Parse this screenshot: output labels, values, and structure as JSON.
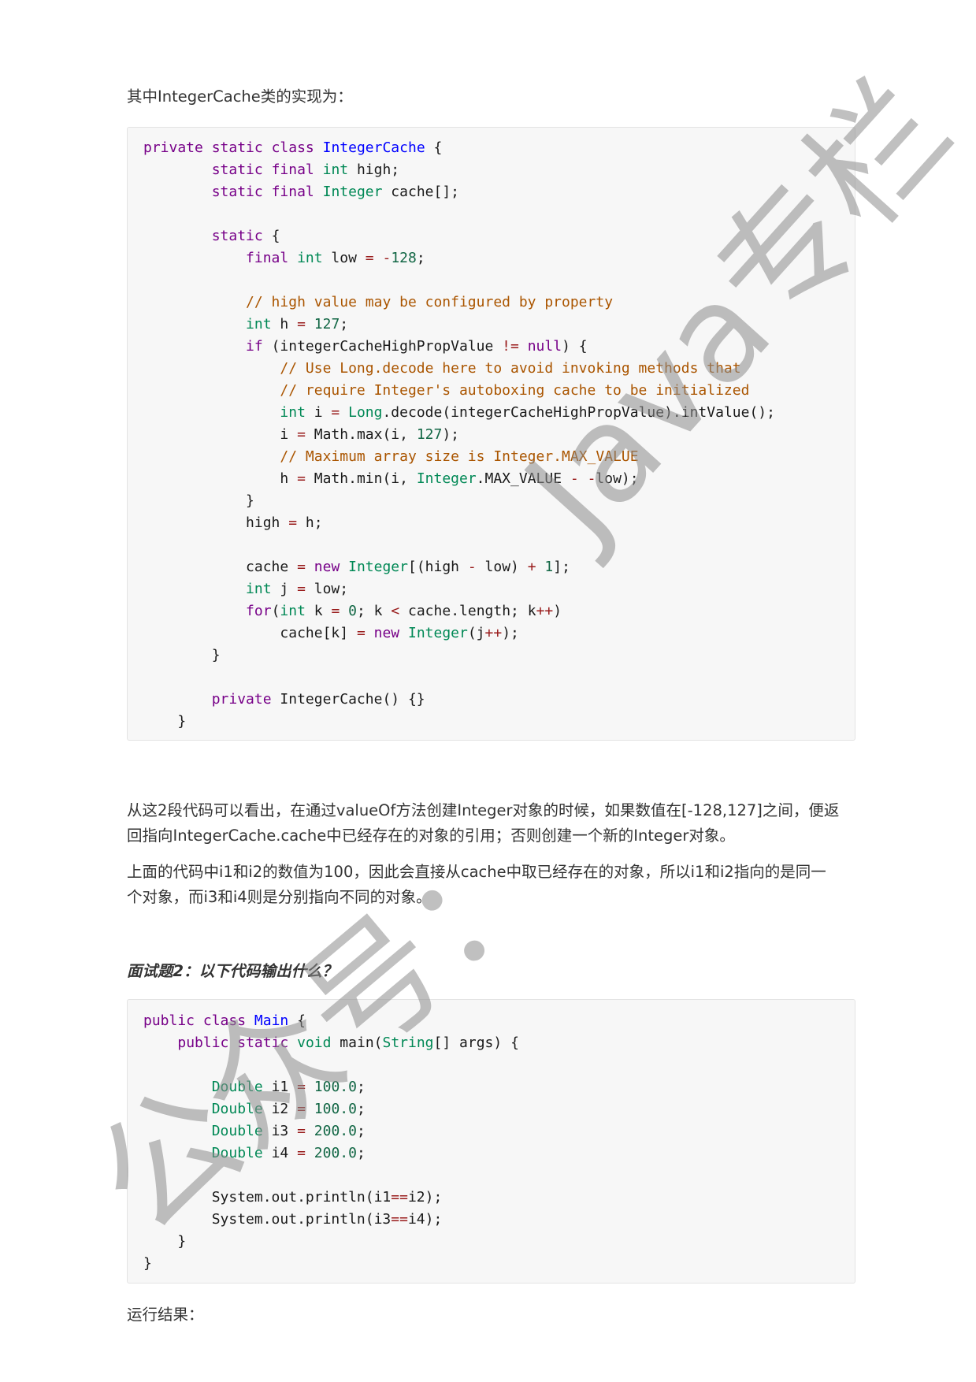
{
  "intro_text": "其中IntegerCache类的实现为：",
  "code_block_1": [
    [
      [
        "kw",
        "private"
      ],
      [
        "p",
        " "
      ],
      [
        "kw",
        "static"
      ],
      [
        "p",
        " "
      ],
      [
        "kw",
        "class"
      ],
      [
        "p",
        " "
      ],
      [
        "cl",
        "IntegerCache"
      ],
      [
        "p",
        " {"
      ]
    ],
    [
      [
        "p",
        "        "
      ],
      [
        "kw",
        "static"
      ],
      [
        "p",
        " "
      ],
      [
        "kw",
        "final"
      ],
      [
        "p",
        " "
      ],
      [
        "ty",
        "int"
      ],
      [
        "p",
        " high;"
      ]
    ],
    [
      [
        "p",
        "        "
      ],
      [
        "kw",
        "static"
      ],
      [
        "p",
        " "
      ],
      [
        "kw",
        "final"
      ],
      [
        "p",
        " "
      ],
      [
        "ty",
        "Integer"
      ],
      [
        "p",
        " cache[];"
      ]
    ],
    [],
    [
      [
        "p",
        "        "
      ],
      [
        "kw",
        "static"
      ],
      [
        "p",
        " {"
      ]
    ],
    [
      [
        "p",
        "            "
      ],
      [
        "kw",
        "final"
      ],
      [
        "p",
        " "
      ],
      [
        "ty",
        "int"
      ],
      [
        "p",
        " low "
      ],
      [
        "op",
        "="
      ],
      [
        "p",
        " "
      ],
      [
        "op",
        "-"
      ],
      [
        "num",
        "128"
      ],
      [
        "p",
        ";"
      ]
    ],
    [],
    [
      [
        "p",
        "            "
      ],
      [
        "cm",
        "// high value may be configured by property"
      ]
    ],
    [
      [
        "p",
        "            "
      ],
      [
        "ty",
        "int"
      ],
      [
        "p",
        " h "
      ],
      [
        "op",
        "="
      ],
      [
        "p",
        " "
      ],
      [
        "num",
        "127"
      ],
      [
        "p",
        ";"
      ]
    ],
    [
      [
        "p",
        "            "
      ],
      [
        "kw",
        "if"
      ],
      [
        "p",
        " (integerCacheHighPropValue "
      ],
      [
        "op",
        "!="
      ],
      [
        "p",
        " "
      ],
      [
        "kw",
        "null"
      ],
      [
        "p",
        ") {"
      ]
    ],
    [
      [
        "p",
        "                "
      ],
      [
        "cm",
        "// Use Long.decode here to avoid invoking methods that"
      ]
    ],
    [
      [
        "p",
        "                "
      ],
      [
        "cm",
        "// require Integer's autoboxing cache to be initialized"
      ]
    ],
    [
      [
        "p",
        "                "
      ],
      [
        "ty",
        "int"
      ],
      [
        "p",
        " i "
      ],
      [
        "op",
        "="
      ],
      [
        "p",
        " "
      ],
      [
        "ty",
        "Long"
      ],
      [
        "p",
        ".decode(integerCacheHighPropValue).intValue();"
      ]
    ],
    [
      [
        "p",
        "                i "
      ],
      [
        "op",
        "="
      ],
      [
        "p",
        " Math.max(i, "
      ],
      [
        "num",
        "127"
      ],
      [
        "p",
        ");"
      ]
    ],
    [
      [
        "p",
        "                "
      ],
      [
        "cm",
        "// Maximum array size is Integer.MAX_VALUE"
      ]
    ],
    [
      [
        "p",
        "                h "
      ],
      [
        "op",
        "="
      ],
      [
        "p",
        " Math.min(i, "
      ],
      [
        "ty",
        "Integer"
      ],
      [
        "p",
        ".MAX_VALUE "
      ],
      [
        "op",
        "-"
      ],
      [
        "p",
        " "
      ],
      [
        "op",
        "-"
      ],
      [
        "p",
        "low);"
      ]
    ],
    [
      [
        "p",
        "            }"
      ]
    ],
    [
      [
        "p",
        "            high "
      ],
      [
        "op",
        "="
      ],
      [
        "p",
        " h;"
      ]
    ],
    [],
    [
      [
        "p",
        "            cache "
      ],
      [
        "op",
        "="
      ],
      [
        "p",
        " "
      ],
      [
        "kw",
        "new"
      ],
      [
        "p",
        " "
      ],
      [
        "ty",
        "Integer"
      ],
      [
        "p",
        "[(high "
      ],
      [
        "op",
        "-"
      ],
      [
        "p",
        " low) "
      ],
      [
        "op",
        "+"
      ],
      [
        "p",
        " "
      ],
      [
        "num",
        "1"
      ],
      [
        "p",
        "];"
      ]
    ],
    [
      [
        "p",
        "            "
      ],
      [
        "ty",
        "int"
      ],
      [
        "p",
        " j "
      ],
      [
        "op",
        "="
      ],
      [
        "p",
        " low;"
      ]
    ],
    [
      [
        "p",
        "            "
      ],
      [
        "kw",
        "for"
      ],
      [
        "p",
        "("
      ],
      [
        "ty",
        "int"
      ],
      [
        "p",
        " k "
      ],
      [
        "op",
        "="
      ],
      [
        "p",
        " "
      ],
      [
        "num",
        "0"
      ],
      [
        "p",
        "; k "
      ],
      [
        "op",
        "<"
      ],
      [
        "p",
        " cache.length; k"
      ],
      [
        "op",
        "++"
      ],
      [
        "p",
        ")"
      ]
    ],
    [
      [
        "p",
        "                cache[k] "
      ],
      [
        "op",
        "="
      ],
      [
        "p",
        " "
      ],
      [
        "kw",
        "new"
      ],
      [
        "p",
        " "
      ],
      [
        "ty",
        "Integer"
      ],
      [
        "p",
        "(j"
      ],
      [
        "op",
        "++"
      ],
      [
        "p",
        ");"
      ]
    ],
    [
      [
        "p",
        "        }"
      ]
    ],
    [],
    [
      [
        "p",
        "        "
      ],
      [
        "kw",
        "private"
      ],
      [
        "p",
        " IntegerCache() {}"
      ]
    ],
    [
      [
        "p",
        "    }"
      ]
    ]
  ],
  "explanation_para_1": [
    "从这2段代码可以看出，在通过valueOf方法创建Integer对象的时候，如果数值在[-128,127]之间，便返",
    "回指向IntegerCache.cache中已经存在的对象的引用；否则创建一个新的Integer对象。"
  ],
  "explanation_para_2": [
    "上面的代码中i1和i2的数值为100，因此会直接从cache中取已经存在的对象，所以i1和i2指向的是同一",
    "个对象，而i3和i4则是分别指向不同的对象。"
  ],
  "question_heading": "面试题2：以下代码输出什么？",
  "code_block_2": [
    [
      [
        "kw",
        "public"
      ],
      [
        "p",
        " "
      ],
      [
        "kw",
        "class"
      ],
      [
        "p",
        " "
      ],
      [
        "cl",
        "Main"
      ],
      [
        "p",
        " {"
      ]
    ],
    [
      [
        "p",
        "    "
      ],
      [
        "kw",
        "public"
      ],
      [
        "p",
        " "
      ],
      [
        "kw",
        "static"
      ],
      [
        "p",
        " "
      ],
      [
        "ty",
        "void"
      ],
      [
        "p",
        " main("
      ],
      [
        "ty",
        "String"
      ],
      [
        "p",
        "[] args) {"
      ]
    ],
    [],
    [
      [
        "p",
        "        "
      ],
      [
        "ty",
        "Double"
      ],
      [
        "p",
        " i1 "
      ],
      [
        "op",
        "="
      ],
      [
        "p",
        " "
      ],
      [
        "num",
        "100.0"
      ],
      [
        "p",
        ";"
      ]
    ],
    [
      [
        "p",
        "        "
      ],
      [
        "ty",
        "Double"
      ],
      [
        "p",
        " i2 "
      ],
      [
        "op",
        "="
      ],
      [
        "p",
        " "
      ],
      [
        "num",
        "100.0"
      ],
      [
        "p",
        ";"
      ]
    ],
    [
      [
        "p",
        "        "
      ],
      [
        "ty",
        "Double"
      ],
      [
        "p",
        " i3 "
      ],
      [
        "op",
        "="
      ],
      [
        "p",
        " "
      ],
      [
        "num",
        "200.0"
      ],
      [
        "p",
        ";"
      ]
    ],
    [
      [
        "p",
        "        "
      ],
      [
        "ty",
        "Double"
      ],
      [
        "p",
        " i4 "
      ],
      [
        "op",
        "="
      ],
      [
        "p",
        " "
      ],
      [
        "num",
        "200.0"
      ],
      [
        "p",
        ";"
      ]
    ],
    [],
    [
      [
        "p",
        "        System.out.println(i1"
      ],
      [
        "op",
        "=="
      ],
      [
        "p",
        "i2);"
      ]
    ],
    [
      [
        "p",
        "        System.out.println(i3"
      ],
      [
        "op",
        "=="
      ],
      [
        "p",
        "i4);"
      ]
    ],
    [
      [
        "p",
        "    }"
      ]
    ],
    [
      [
        "p",
        "}"
      ]
    ]
  ],
  "result_label": "运行结果：",
  "watermark": {
    "text_1": "Java专栏",
    "text_2": "公众号：",
    "color": "#8c8c8c"
  },
  "syntax_colors": {
    "keyword": "#770088",
    "type": "#008855",
    "class_name": "#0000ff",
    "number": "#116644",
    "operator": "#981a1a",
    "comment": "#aa5500"
  }
}
